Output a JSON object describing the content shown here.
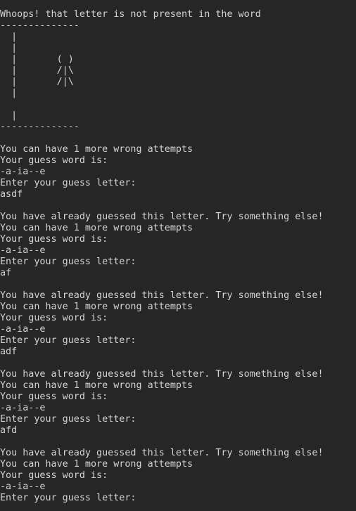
{
  "terminal": {
    "lines": [
      "Whoops! that letter is not present in the word",
      "--------------",
      "  |",
      "  |",
      "  |       ( )",
      "  |       /|\\",
      "  |       /|\\",
      "  |",
      "",
      "  |",
      "--------------",
      "",
      "You can have 1 more wrong attempts",
      "Your guess word is:",
      "-a-ia--e",
      "Enter your guess letter:",
      "asdf",
      "",
      "You have already guessed this letter. Try something else!",
      "You can have 1 more wrong attempts",
      "Your guess word is:",
      "-a-ia--e",
      "Enter your guess letter:",
      "af",
      "",
      "You have already guessed this letter. Try something else!",
      "You can have 1 more wrong attempts",
      "Your guess word is:",
      "-a-ia--e",
      "Enter your guess letter:",
      "adf",
      "",
      "You have already guessed this letter. Try something else!",
      "You can have 1 more wrong attempts",
      "Your guess word is:",
      "-a-ia--e",
      "Enter your guess letter:",
      "afd",
      "",
      "You have already guessed this letter. Try something else!",
      "You can have 1 more wrong attempts",
      "Your guess word is:",
      "-a-ia--e",
      "Enter your guess letter:"
    ]
  }
}
